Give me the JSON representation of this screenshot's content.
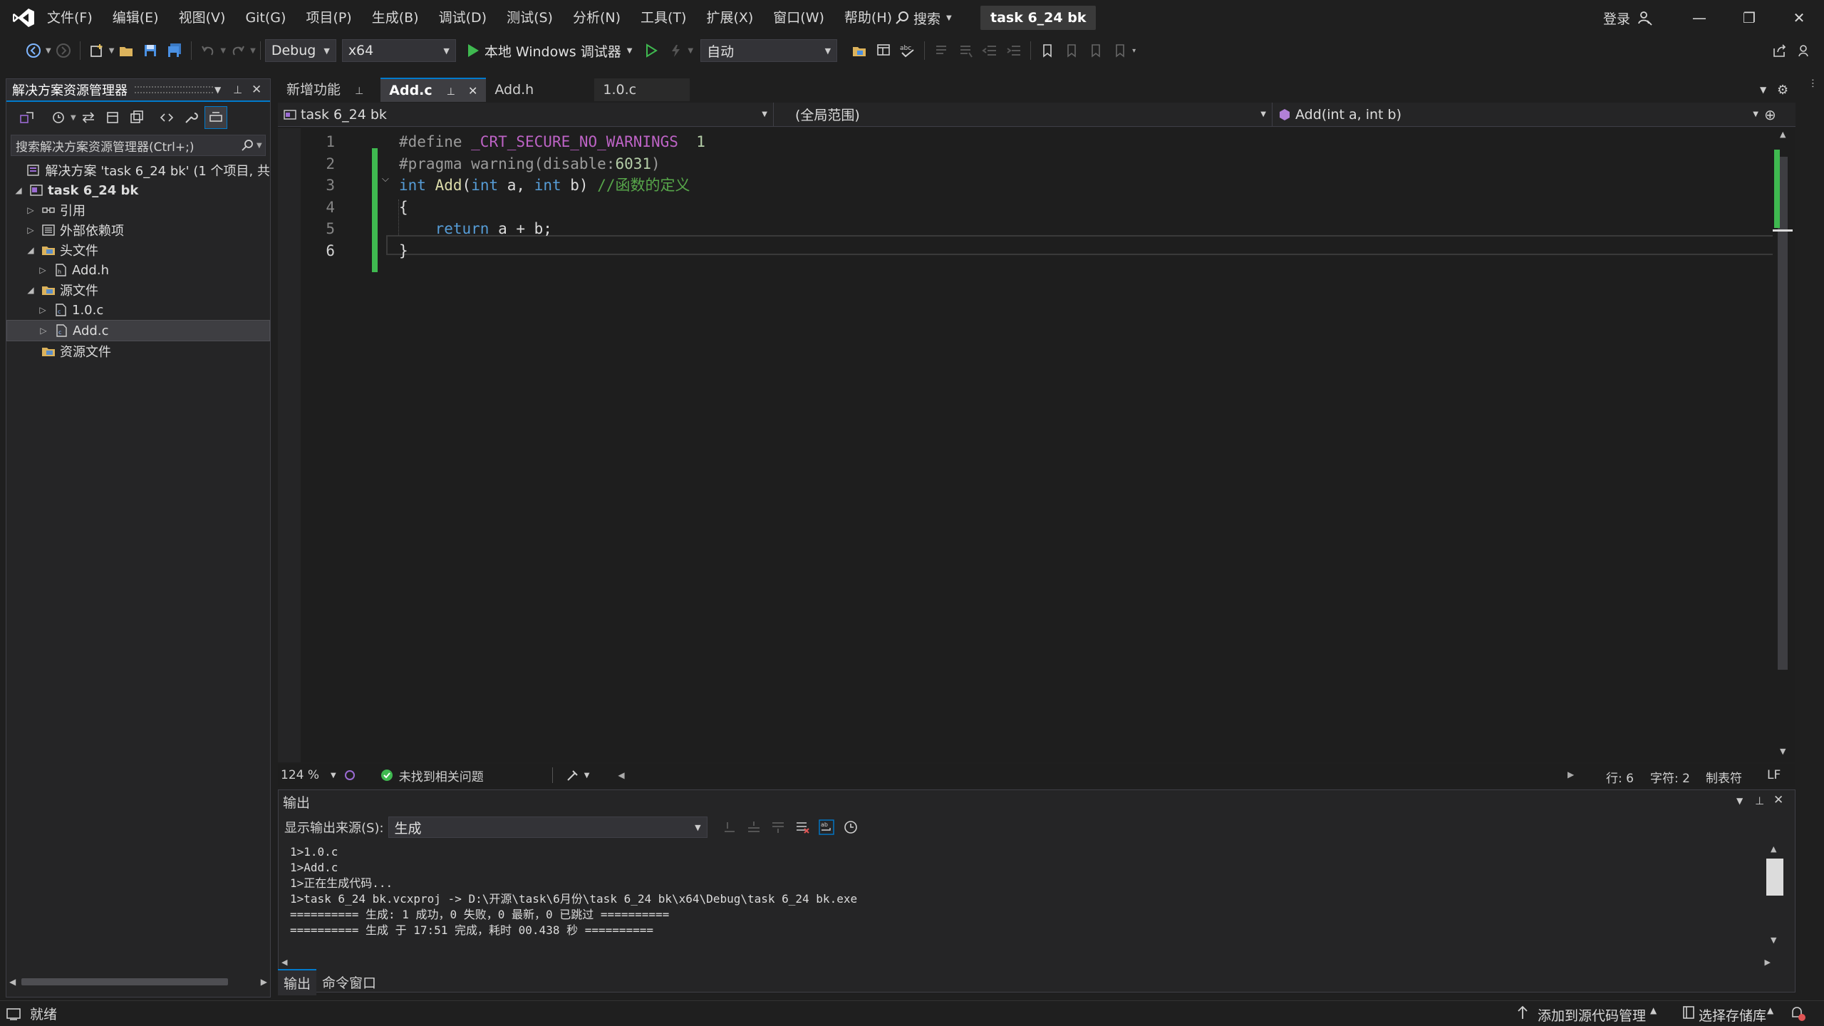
{
  "window": {
    "menu": [
      "文件(F)",
      "编辑(E)",
      "视图(V)",
      "Git(G)",
      "项目(P)",
      "生成(B)",
      "调试(D)",
      "测试(S)",
      "分析(N)",
      "工具(T)",
      "扩展(X)",
      "窗口(W)",
      "帮助(H)"
    ],
    "search_label": "搜索",
    "project_chip": "task 6_24 bk",
    "login_label": "登录"
  },
  "toolbar": {
    "config": "Debug",
    "platform": "x64",
    "run_label": "本地 Windows 调试器",
    "mode": "自动"
  },
  "solution_explorer": {
    "title": "解决方案资源管理器",
    "search_placeholder": "搜索解决方案资源管理器(Ctrl+;)",
    "tree": [
      {
        "label": "解决方案 'task 6_24 bk' (1 个项目, 共",
        "indent": 0,
        "exp": "",
        "icon": "solution-icon",
        "bold": false
      },
      {
        "label": "task 6_24 bk",
        "indent": 0,
        "exp": "◢",
        "icon": "project-icon",
        "bold": true
      },
      {
        "label": "引用",
        "indent": 1,
        "exp": "▷",
        "icon": "references-icon",
        "bold": false
      },
      {
        "label": "外部依赖项",
        "indent": 1,
        "exp": "▷",
        "icon": "external-deps-icon",
        "bold": false
      },
      {
        "label": "头文件",
        "indent": 1,
        "exp": "◢",
        "icon": "folder-icon",
        "bold": false
      },
      {
        "label": "Add.h",
        "indent": 2,
        "exp": "▷",
        "icon": "header-file-icon",
        "bold": false
      },
      {
        "label": "源文件",
        "indent": 1,
        "exp": "◢",
        "icon": "folder-icon",
        "bold": false
      },
      {
        "label": "1.0.c",
        "indent": 2,
        "exp": "▷",
        "icon": "c-file-icon",
        "bold": false
      },
      {
        "label": "Add.c",
        "indent": 2,
        "exp": "▷",
        "icon": "c-file-icon",
        "bold": false,
        "selected": true
      },
      {
        "label": "资源文件",
        "indent": 1,
        "exp": "",
        "icon": "folder-icon",
        "bold": false
      }
    ]
  },
  "editor": {
    "tabs": [
      {
        "label": "新增功能",
        "active": false,
        "pinned": true
      },
      {
        "label": "Add.c",
        "active": true,
        "pinned": true,
        "closable": true
      },
      {
        "label": "Add.h",
        "active": false
      },
      {
        "label": "1.0.c",
        "active": false
      }
    ],
    "nav": {
      "project": "task 6_24 bk",
      "scope": "(全局范围)",
      "member": "Add(int a, int b)"
    },
    "code": [
      {
        "n": "1",
        "tokens": [
          [
            "pp",
            "#define "
          ],
          [
            "mac",
            "_CRT_SECURE_NO_WARNINGS"
          ],
          [
            "pl",
            "  "
          ],
          [
            "num",
            "1"
          ]
        ]
      },
      {
        "n": "2",
        "tokens": [
          [
            "pp",
            "#pragma warning(disable:"
          ],
          [
            "num",
            "6031"
          ],
          [
            "pp",
            ")"
          ]
        ]
      },
      {
        "n": "3",
        "tokens": [
          [
            "kw",
            "int"
          ],
          [
            "pl",
            " "
          ],
          [
            "fn",
            "Add"
          ],
          [
            "pl",
            "("
          ],
          [
            "kw",
            "int"
          ],
          [
            "pl",
            " a, "
          ],
          [
            "kw",
            "int"
          ],
          [
            "pl",
            " b) "
          ],
          [
            "cm",
            "//函数的定义"
          ]
        ]
      },
      {
        "n": "4",
        "tokens": [
          [
            "pl",
            "{"
          ]
        ]
      },
      {
        "n": "5",
        "tokens": [
          [
            "pl",
            "    "
          ],
          [
            "kw",
            "return"
          ],
          [
            "pl",
            " a + b;"
          ]
        ]
      },
      {
        "n": "6",
        "tokens": [
          [
            "pl",
            "}"
          ]
        ]
      }
    ],
    "status": {
      "zoom": "124 %",
      "issues": "未找到相关问题",
      "line": "行: 6",
      "col": "字符: 2",
      "indent": "制表符",
      "eol": "LF"
    }
  },
  "output": {
    "title": "输出",
    "source_label": "显示输出来源(S):",
    "source_value": "生成",
    "lines": [
      "1>1.0.c",
      "1>Add.c",
      "1>正在生成代码...",
      "1>task 6_24 bk.vcxproj -> D:\\开源\\task\\6月份\\task 6_24 bk\\x64\\Debug\\task 6_24 bk.exe",
      "========== 生成: 1 成功，0 失败，0 最新，0 已跳过 ==========",
      "========== 生成 于 17:51 完成，耗时 00.438 秒 =========="
    ],
    "bottom_tabs": [
      "输出",
      "命令窗口"
    ]
  },
  "statusbar": {
    "ready": "就绪",
    "add_source": "添加到源代码管理",
    "select_repo": "选择存储库"
  },
  "colors": {
    "accent": "#007acc",
    "vs_purple": "#9b6bd3",
    "success": "#3fb950",
    "changed_bar": "#3fb950"
  }
}
